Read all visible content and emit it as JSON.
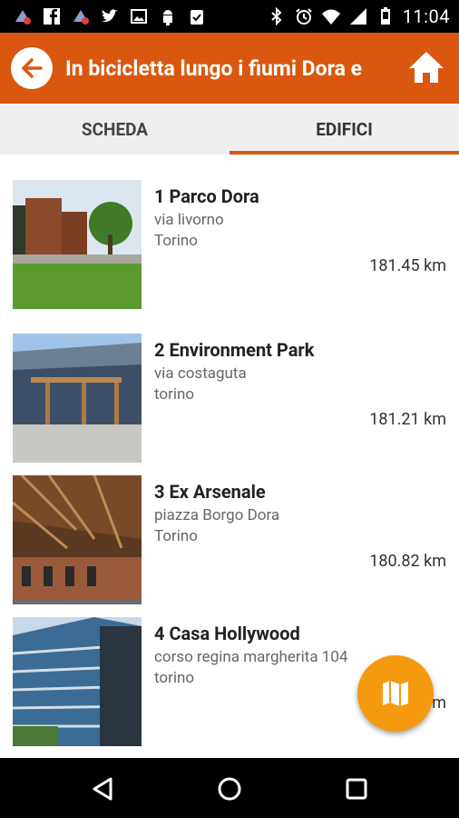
{
  "status_bar": {
    "time": "11:04",
    "left_icons": [
      "notification-icon",
      "facebook-icon",
      "notification-icon",
      "twitter-icon",
      "image-icon",
      "android-icon",
      "clipboard-icon"
    ],
    "right_icons": [
      "bluetooth-icon",
      "alarm-icon",
      "wifi-icon",
      "signal-icon",
      "battery-icon"
    ]
  },
  "app_bar": {
    "title": "In bicicletta lungo i fiumi Dora e",
    "color": "#D9570E"
  },
  "tabs": [
    {
      "label": "SCHEDA",
      "active": false
    },
    {
      "label": "EDIFICI",
      "active": true
    }
  ],
  "items": [
    {
      "name": "1 Parco Dora",
      "address": "via livorno",
      "city": "Torino",
      "distance": "181.45 km"
    },
    {
      "name": "2 Environment Park",
      "address": "via costaguta",
      "city": "torino",
      "distance": "181.21 km"
    },
    {
      "name": "3 Ex Arsenale",
      "address": "piazza Borgo Dora",
      "city": "Torino",
      "distance": "180.82 km"
    },
    {
      "name": "4 Casa Hollywood",
      "address": "corso regina margherita 104",
      "city": "torino",
      "distance": "m"
    }
  ],
  "fab": {
    "icon": "map-icon",
    "color": "#F59A0E"
  }
}
